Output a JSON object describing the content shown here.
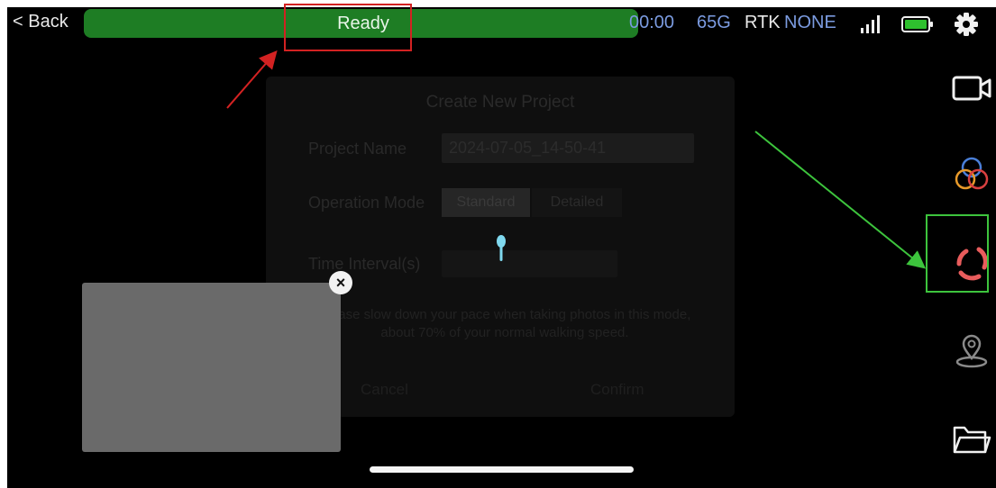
{
  "status_bar": {
    "back_label": "< Back",
    "status_text": "Ready",
    "recording_time": "00:00",
    "storage": "65G",
    "rtk_label": "RTK",
    "rtk_value": "NONE"
  },
  "dialog": {
    "title": "Create New Project",
    "project_name_label": "Project Name",
    "project_name_value": "2024-07-05_14-50-41",
    "operation_mode_label": "Operation Mode",
    "mode_options": [
      "Standard",
      "Detailed"
    ],
    "selected_mode": "Standard",
    "time_interval_label": "Time Interval(s)",
    "tip_text": "Please slow down your pace when taking photos in this mode, about 70% of your normal walking speed.",
    "cancel_label": "Cancel",
    "confirm_label": "Confirm"
  },
  "preview": {
    "close_symbol": "×"
  },
  "toolbar": {
    "icons": [
      "video-camera-icon",
      "color-circles-icon",
      "scan-ring-icon",
      "location-pin-icon",
      "folder-icon"
    ]
  },
  "colors": {
    "status_green": "#1e7d24",
    "accent_blue": "#7b9be0",
    "annotation_red": "#d32222",
    "annotation_green": "#3dc43d",
    "scan_ring_red": "#e85c5c"
  }
}
